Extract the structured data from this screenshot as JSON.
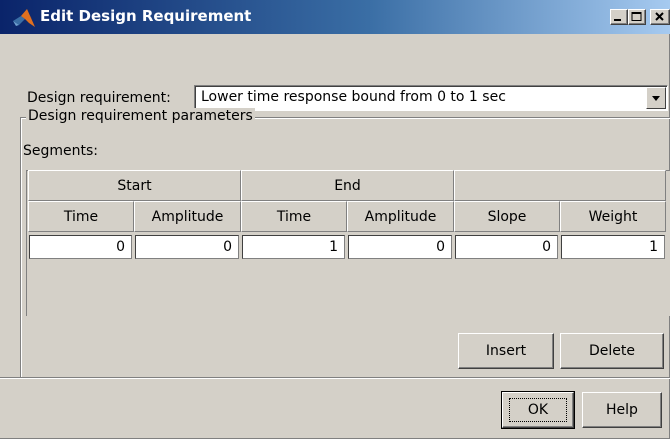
{
  "window": {
    "title": "Edit Design Requirement",
    "controls": {
      "minimize": "_",
      "maximize": "□",
      "close": "X"
    }
  },
  "requirement": {
    "label": "Design requirement:",
    "selected": "Lower time response bound from 0 to 1 sec"
  },
  "parameters": {
    "group_label": "Design requirement parameters",
    "segments_label": "Segments:",
    "group_headers": [
      "Start",
      "End",
      ""
    ],
    "columns": [
      "Time",
      "Amplitude",
      "Time",
      "Amplitude",
      "Slope",
      "Weight"
    ],
    "rows": [
      [
        "0",
        "0",
        "1",
        "0",
        "0",
        "1"
      ]
    ]
  },
  "buttons": {
    "insert": "Insert",
    "delete": "Delete",
    "ok": "OK",
    "help": "Help"
  }
}
